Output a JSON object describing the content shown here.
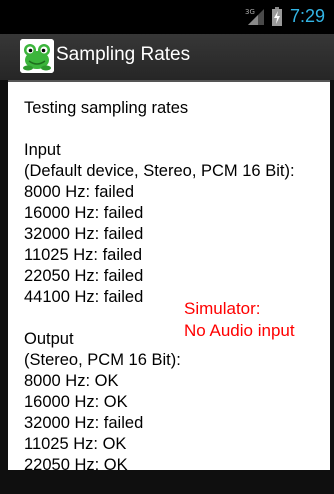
{
  "status_bar": {
    "network": "3G",
    "time": "7:29",
    "time_color": "#33b5e5"
  },
  "action_bar": {
    "title": "Sampling Rates",
    "icon": "frog-app-icon"
  },
  "content": {
    "heading": "Testing sampling rates",
    "input": {
      "label": "Input",
      "subtitle": "(Default device, Stereo, PCM 16 Bit):",
      "results": [
        "8000 Hz: failed",
        "16000 Hz: failed",
        "32000 Hz: failed",
        "11025 Hz: failed",
        "22050 Hz: failed",
        "44100 Hz: failed"
      ]
    },
    "output": {
      "label": "Output",
      "subtitle": "(Stereo, PCM 16 Bit):",
      "results": [
        "8000 Hz: OK",
        "16000 Hz: OK",
        "32000 Hz: failed",
        "11025 Hz: OK",
        "22050 Hz: OK"
      ]
    }
  },
  "annotation": {
    "line1": "Simulator:",
    "line2": "No Audio input",
    "color": "#ff0000"
  }
}
